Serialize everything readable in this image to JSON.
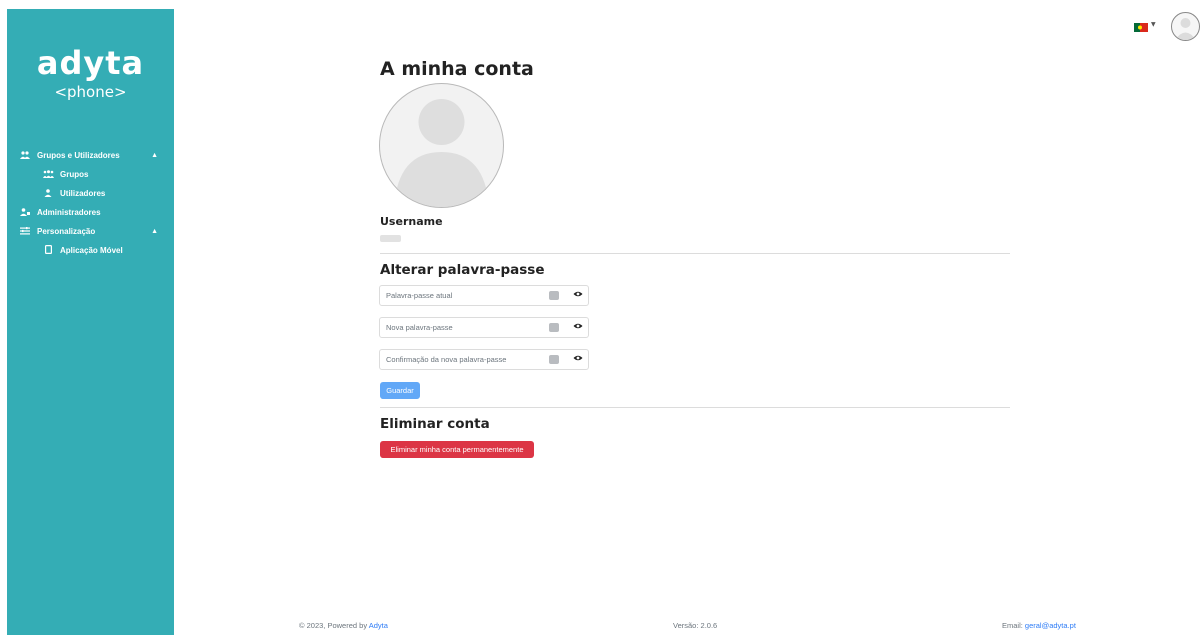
{
  "sidebar": {
    "logo_main": "adyta",
    "logo_sub": "<phone>",
    "items": [
      {
        "label": "Grupos e Utilizadores",
        "icon": "users-icon",
        "expanded": true
      },
      {
        "label": "Grupos",
        "icon": "groups-icon"
      },
      {
        "label": "Utilizadores",
        "icon": "user-icon"
      },
      {
        "label": "Administradores",
        "icon": "admin-icon"
      },
      {
        "label": "Personalização",
        "icon": "sliders-icon",
        "expanded": true
      },
      {
        "label": "Aplicação Móvel",
        "icon": "mobile-icon"
      }
    ]
  },
  "header": {
    "language_flag": "portugal-flag-icon"
  },
  "main": {
    "title": "A minha conta",
    "username_label": "Username",
    "change_password_title": "Alterar palavra-passe",
    "fields": [
      {
        "placeholder": "Palavra-passe atual"
      },
      {
        "placeholder": "Nova palavra-passe"
      },
      {
        "placeholder": "Confirmação da nova palavra-passe"
      }
    ],
    "save_label": "Guardar",
    "delete_title": "Eliminar conta",
    "delete_label": "Eliminar minha conta permanentemente"
  },
  "footer": {
    "copyright_prefix": "© 2023, Powered by ",
    "copyright_link": "Adyta",
    "version": "Versão: 2.0.6",
    "email_prefix": "Email: ",
    "email_link": "geral@adyta.pt"
  },
  "colors": {
    "sidebar": "#34adb5",
    "primary": "#62a8f7",
    "danger": "#dc3545",
    "link": "#2e7cf6"
  }
}
